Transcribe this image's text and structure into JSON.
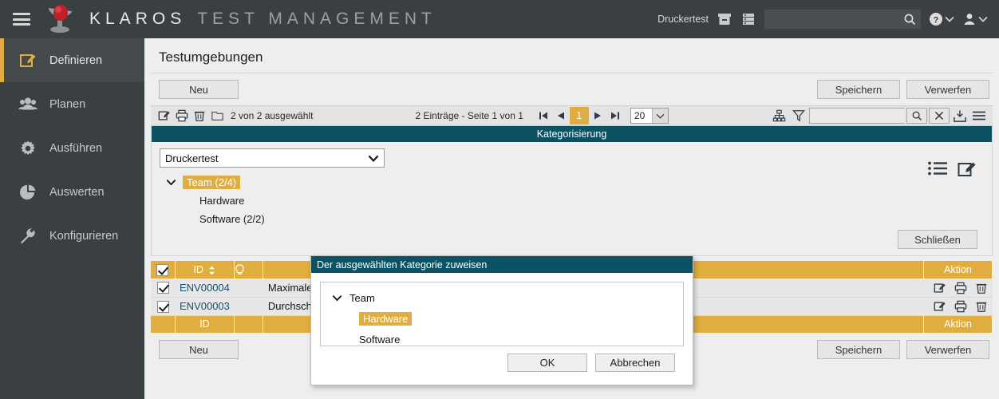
{
  "colors": {
    "dark": "#3a3f41",
    "teal": "#0b5265",
    "gold": "#e0ad41",
    "panel": "#eeeeee",
    "row": "#e7e7e7"
  },
  "topbar": {
    "menu_icon": "hamburger-icon",
    "logo_icon": "klaros-logo-icon",
    "brand": "KLAROS",
    "brand_sub": "TEST MANAGEMENT",
    "project": "Druckertest",
    "archive_icon": "archive-icon",
    "database_icon": "database-icon",
    "search_value": "",
    "search_placeholder": "",
    "search_icon": "search-icon",
    "help_icon": "help-icon",
    "user_icon": "user-icon",
    "chevron_icon": "chevron-down-icon"
  },
  "sidebar": {
    "items": [
      {
        "label": "Definieren",
        "icon": "edit-square-icon",
        "active": true
      },
      {
        "label": "Planen",
        "icon": "people-icon",
        "active": false
      },
      {
        "label": "Ausführen",
        "icon": "gear-icon",
        "active": false
      },
      {
        "label": "Auswerten",
        "icon": "pie-chart-icon",
        "active": false
      },
      {
        "label": "Konfigurieren",
        "icon": "wrench-icon",
        "active": false
      }
    ]
  },
  "page": {
    "title": "Testumgebungen"
  },
  "toolbar_top": {
    "new_label": "Neu",
    "save_label": "Speichern",
    "discard_label": "Verwerfen"
  },
  "listbar": {
    "edit_icon": "edit-square-icon",
    "print_icon": "printer-icon",
    "delete_icon": "trash-icon",
    "folder_icon": "folder-icon",
    "selection_text": "2 von 2 ausgewählt",
    "entries_text": "2 Einträge - Seite 1 von 1",
    "first_icon": "first-page-icon",
    "prev_icon": "prev-page-icon",
    "page_number": "1",
    "next_icon": "next-page-icon",
    "last_icon": "last-page-icon",
    "page_size": "20",
    "page_size_chevron": "chevron-down-icon",
    "hierarchy_icon": "hierarchy-icon",
    "filter_icon": "funnel-icon",
    "filter_value": "",
    "search_icon": "search-icon",
    "clear_icon": "close-icon",
    "export_icon": "download-icon",
    "menu_icon": "menu-icon"
  },
  "categorization": {
    "header": "Kategorisierung",
    "select_value": "Druckertest",
    "select_chevron": "chevron-down-icon",
    "tree": [
      {
        "label": "Team (2/4)",
        "level": 0,
        "highlight": true,
        "expander": "chevron-down-icon"
      },
      {
        "label": "Hardware",
        "level": 1,
        "highlight": false
      },
      {
        "label": "Software (2/2)",
        "level": 1,
        "highlight": false
      }
    ],
    "list_icon": "list-icon",
    "edit_icon": "edit-square-icon",
    "close_label": "Schließen"
  },
  "table": {
    "headers": [
      "",
      "ID",
      "",
      "",
      "Aktion"
    ],
    "id_header": "ID",
    "sort_icon": "sort-icon",
    "bulb_icon": "lightbulb-icon",
    "action_header": "Aktion",
    "footer_id": "ID",
    "footer_action": "Aktion",
    "rows": [
      {
        "checked": true,
        "id": "ENV00004",
        "name": "Maximale R",
        "actions": [
          "edit-square-icon",
          "printer-icon",
          "trash-icon"
        ]
      },
      {
        "checked": true,
        "id": "ENV00003",
        "name": "Durchschnit",
        "actions": [
          "edit-square-icon",
          "printer-icon",
          "trash-icon"
        ]
      }
    ],
    "header_checked": true
  },
  "toolbar_bottom": {
    "new_label": "Neu",
    "save_label": "Speichern",
    "discard_label": "Verwerfen"
  },
  "modal": {
    "title": "Der ausgewählten Kategorie zuweisen",
    "tree": [
      {
        "label": "Team",
        "level": 0,
        "highlight": false,
        "expander": "chevron-down-icon"
      },
      {
        "label": "Hardware",
        "level": 1,
        "highlight": true
      },
      {
        "label": "Software",
        "level": 1,
        "highlight": false
      }
    ],
    "ok_label": "OK",
    "cancel_label": "Abbrechen"
  }
}
